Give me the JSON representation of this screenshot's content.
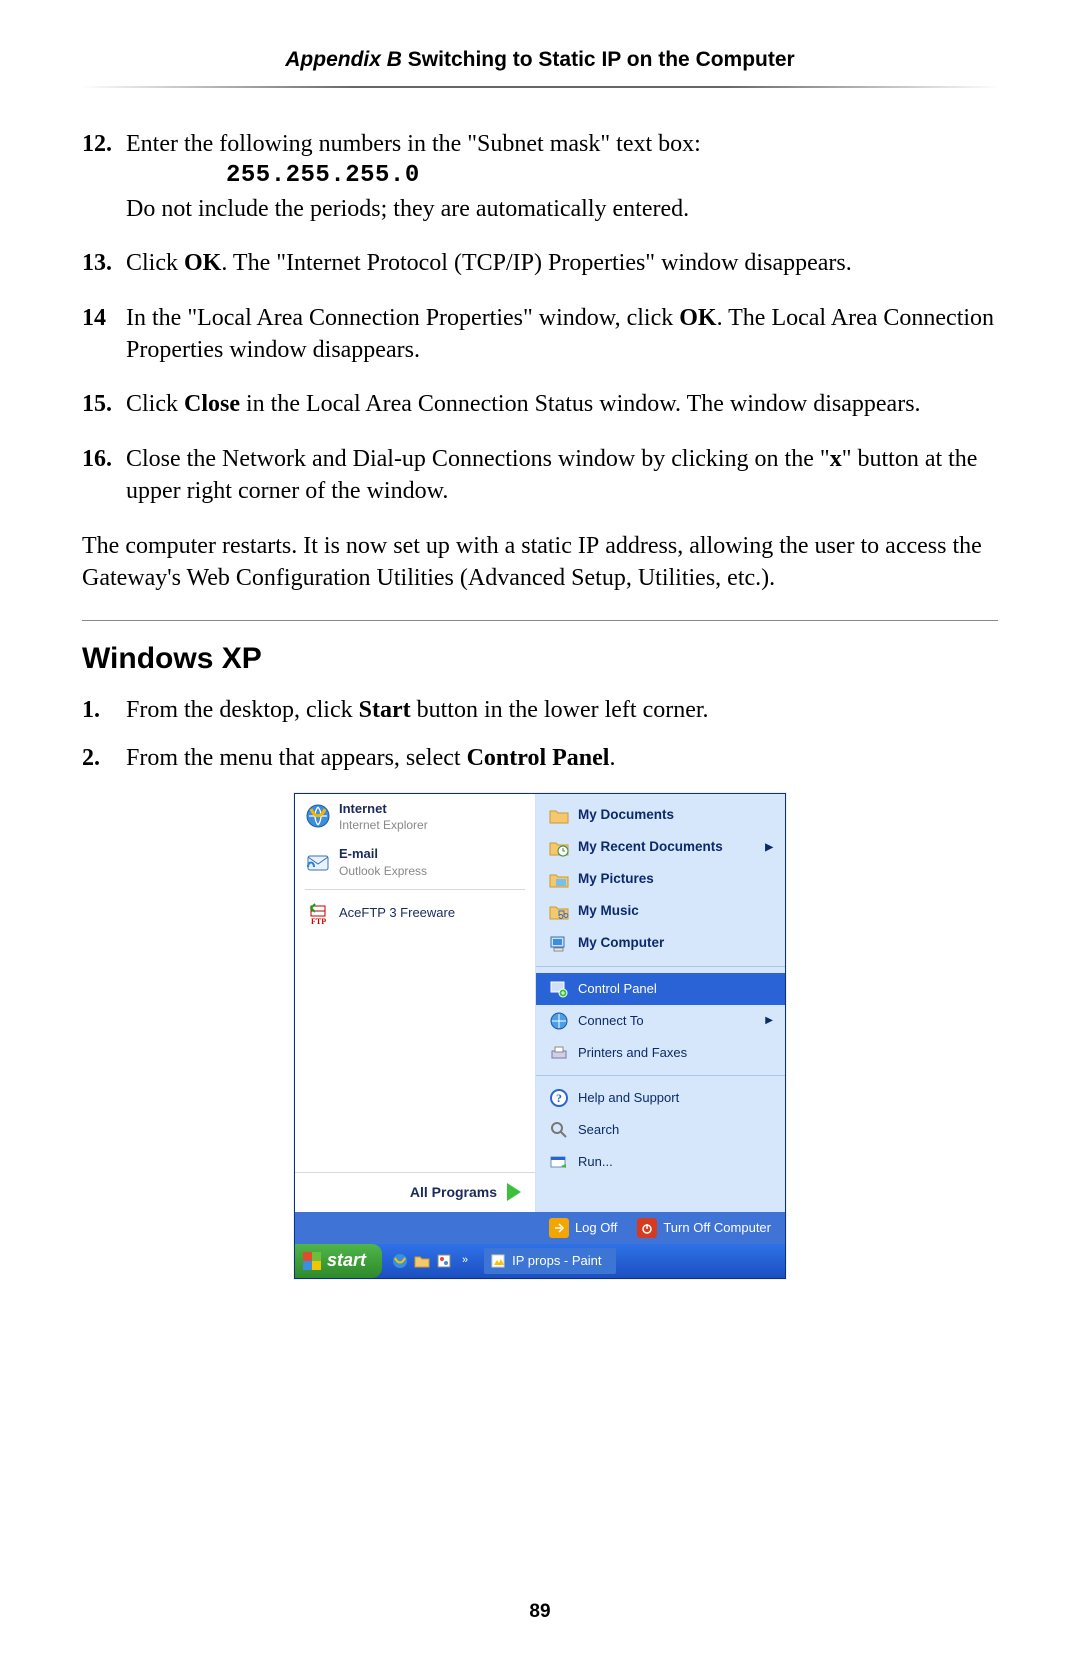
{
  "header": {
    "bold": "Appendix B",
    "rest": "  Switching to Static IP on the Computer"
  },
  "steps": [
    {
      "n": "12.",
      "lines": {
        "a": "Enter the following numbers in the \"Subnet mask\" text box:",
        "mono": "255.255.255.0",
        "b": "Do not include the periods; they are automatically entered."
      }
    },
    {
      "n": "13.",
      "text_a": "Click ",
      "ok": "OK",
      "text_b": ". The \"Internet Protocol (",
      "tcpip": "TCP/IP",
      "text_c": ") Properties\" window disappears."
    },
    {
      "n": "14",
      "text_a": "In the \"Local Area Connection Properties\" window, click ",
      "ok": "OK",
      "text_b": ". The Local Area Connection Properties window disappears."
    },
    {
      "n": "15.",
      "text_a": "Click ",
      "close": "Close",
      "text_b": " in the Local Area Connection Status window. The window disappears."
    },
    {
      "n": "16.",
      "text_a": "Close the Network and Dial-up Connections window by clicking on the \"",
      "x": "x",
      "text_b": "\" button at the upper right corner of the window."
    }
  ],
  "para": {
    "a": "The computer restarts. It is now set up with a static ",
    "ip": "IP",
    "b": " address, allowing the user to access the Gateway's Web Configuration Utilities (Advanced Setup, Utilities, etc.)."
  },
  "section": "Windows XP",
  "sub": [
    {
      "n": "1.",
      "a": "From the desktop, click ",
      "b": "Start",
      "c": " button in the lower left corner."
    },
    {
      "n": "2.",
      "a": "From the menu that appears, select ",
      "b": "Control Panel",
      "c": "."
    }
  ],
  "xp": {
    "left": {
      "internet": {
        "t": "Internet",
        "s": "Internet Explorer"
      },
      "email": {
        "t": "E-mail",
        "s": "Outlook Express"
      },
      "ace": "AceFTP 3 Freeware",
      "allprograms": "All Programs"
    },
    "right": {
      "mydoc": "My Documents",
      "recent": "My Recent Documents",
      "pics": "My Pictures",
      "music": "My Music",
      "comp": "My Computer",
      "cpanel": "Control Panel",
      "connect": "Connect To",
      "printers": "Printers and Faxes",
      "help": "Help and Support",
      "search": "Search",
      "run": "Run..."
    },
    "logoff": {
      "log": "Log Off",
      "turn": "Turn Off Computer"
    },
    "taskbar": {
      "start": "start",
      "task": "IP props - Paint"
    }
  },
  "pagenum": "89"
}
